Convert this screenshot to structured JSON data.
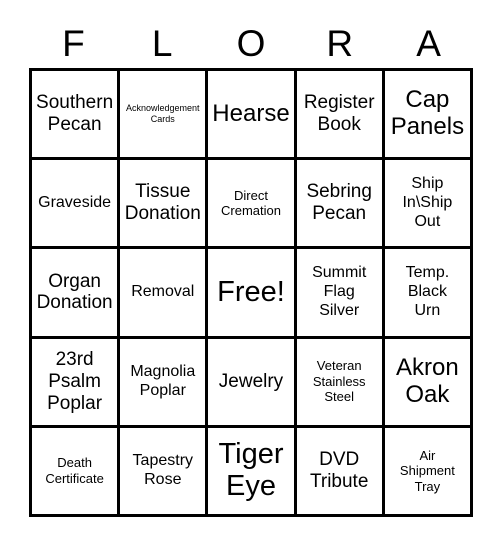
{
  "header": {
    "letters": [
      "F",
      "L",
      "O",
      "R",
      "A"
    ]
  },
  "grid": {
    "columns": 5,
    "rows": 5,
    "border_color": "#000000",
    "background_color": "#ffffff",
    "text_color": "#000000",
    "cells": [
      {
        "text": "Southern\nPecan",
        "size": "l"
      },
      {
        "text": "Acknowledgement\nCards",
        "size": "xs"
      },
      {
        "text": "Hearse",
        "size": "xl"
      },
      {
        "text": "Register\nBook",
        "size": "l"
      },
      {
        "text": "Cap\nPanels",
        "size": "xl"
      },
      {
        "text": "Graveside",
        "size": "m"
      },
      {
        "text": "Tissue\nDonation",
        "size": "l"
      },
      {
        "text": "Direct\nCremation",
        "size": "s"
      },
      {
        "text": "Sebring\nPecan",
        "size": "l"
      },
      {
        "text": "Ship\nIn\\Ship\nOut",
        "size": "m"
      },
      {
        "text": "Organ\nDonation",
        "size": "l"
      },
      {
        "text": "Removal",
        "size": "m"
      },
      {
        "text": "Free!",
        "size": "xxl"
      },
      {
        "text": "Summit\nFlag\nSilver",
        "size": "m"
      },
      {
        "text": "Temp.\nBlack\nUrn",
        "size": "m"
      },
      {
        "text": "23rd\nPsalm\nPoplar",
        "size": "l"
      },
      {
        "text": "Magnolia\nPoplar",
        "size": "m"
      },
      {
        "text": "Jewelry",
        "size": "l"
      },
      {
        "text": "Veteran\nStainless\nSteel",
        "size": "s"
      },
      {
        "text": "Akron\nOak",
        "size": "xl"
      },
      {
        "text": "Death\nCertificate",
        "size": "s"
      },
      {
        "text": "Tapestry\nRose",
        "size": "m"
      },
      {
        "text": "Tiger\nEye",
        "size": "xxl"
      },
      {
        "text": "DVD\nTribute",
        "size": "l"
      },
      {
        "text": "Air\nShipment\nTray",
        "size": "s"
      }
    ]
  }
}
